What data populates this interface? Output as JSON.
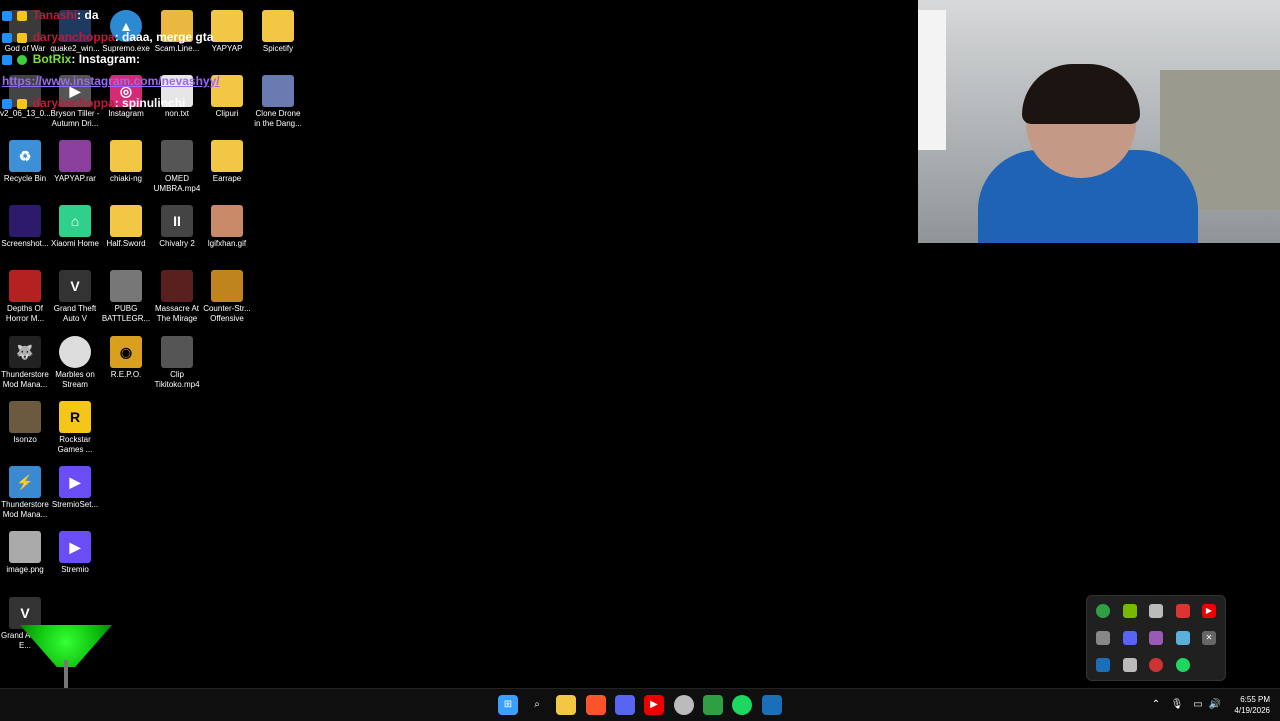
{
  "chat": [
    {
      "user": "Tanashi",
      "message": ": da",
      "user_color": "#c2183c",
      "message_color": "#ffffff"
    },
    {
      "user": "daryanchoppa",
      "message": ": daaa, merge gta",
      "user_color": "#c2183c",
      "message_color": "#ffffff"
    },
    {
      "user": "BotRix",
      "message": ": Instagram:",
      "user_color": "#7ee23e",
      "message_color": "#ffffff"
    },
    {
      "user": "",
      "message": "https://www.instagram.com/nevashyy/",
      "user_color": "#9a6af7",
      "message_color": "#9a6af7"
    },
    {
      "user": "daryanchoppa",
      "message": ": spinulinchi",
      "user_color": "#c2183c",
      "message_color": "#ffffff"
    }
  ],
  "desktop_icons": [
    {
      "label": "God of War",
      "icon": "god-of-war-icon",
      "color": "#3a3a3a"
    },
    {
      "label": "quake2_win...",
      "icon": "quake-installer-icon",
      "color": "#1e3a5f"
    },
    {
      "label": "Supremo.exe",
      "icon": "supremo-icon",
      "color": "#2b8ad1"
    },
    {
      "label": "Scam.Line...",
      "icon": "scam-line-folder-icon",
      "color": "#e8b840"
    },
    {
      "label": "YAPYAP",
      "icon": "folder-icon",
      "color": "#f2c744"
    },
    {
      "label": "Spicetify",
      "icon": "folder-icon",
      "color": "#f2c744"
    },
    {
      "label": "v2_06_13_0...",
      "icon": "video-file-icon",
      "color": "#444"
    },
    {
      "label": "Bryson Tiller - Autumn Dri...",
      "icon": "audio-file-icon",
      "color": "#555"
    },
    {
      "label": "Instagram",
      "icon": "instagram-icon",
      "color": "#d62976"
    },
    {
      "label": "non.txt",
      "icon": "text-file-icon",
      "color": "#e6e6e6"
    },
    {
      "label": "Clipuri",
      "icon": "folder-icon",
      "color": "#f2c744"
    },
    {
      "label": "Clone Drone in the Dang...",
      "icon": "clone-drone-icon",
      "color": "#6a7bb2"
    },
    {
      "label": "Recycle Bin",
      "icon": "recycle-bin-icon",
      "color": "#3d8fd6"
    },
    {
      "label": "YAPYAP.rar",
      "icon": "winrar-icon",
      "color": "#8a3f9c"
    },
    {
      "label": "chiaki-ng",
      "icon": "folder-icon",
      "color": "#f2c744"
    },
    {
      "label": "OMED UMBRA.mp4",
      "icon": "video-file-icon",
      "color": "#555"
    },
    {
      "label": "Earrape",
      "icon": "folder-icon",
      "color": "#f2c744"
    },
    {
      "label": "Screenshot...",
      "icon": "image-file-icon",
      "color": "#2b1b6a"
    },
    {
      "label": "Xiaomi Home",
      "icon": "xiaomi-home-icon",
      "color": "#2fd08a"
    },
    {
      "label": "Half.Sword",
      "icon": "folder-icon",
      "color": "#f2c744"
    },
    {
      "label": "Chivalry 2",
      "icon": "chivalry-icon",
      "color": "#444"
    },
    {
      "label": "lgifxhan.gif",
      "icon": "gif-file-icon",
      "color": "#c98a6a"
    },
    {
      "label": "Depths Of Horror M...",
      "icon": "depths-of-horror-icon",
      "color": "#b52020"
    },
    {
      "label": "Grand Theft Auto V",
      "icon": "gta-v-icon",
      "color": "#333"
    },
    {
      "label": "PUBG BATTLEGR...",
      "icon": "pubg-icon",
      "color": "#777"
    },
    {
      "label": "Massacre At The Mirage",
      "icon": "massacre-icon",
      "color": "#5a2020"
    },
    {
      "label": "Counter-Str... Offensive",
      "icon": "csgo-icon",
      "color": "#c0841e"
    },
    {
      "label": "Thunderstore Mod Mana...",
      "icon": "thunderstore-icon",
      "color": "#222"
    },
    {
      "label": "Marbles on Stream",
      "icon": "marbles-icon",
      "color": "#ddd"
    },
    {
      "label": "R.E.P.O.",
      "icon": "repo-icon",
      "color": "#d9a020"
    },
    {
      "label": "Clip Tikitoko.mp4",
      "icon": "video-file-icon",
      "color": "#555"
    },
    {
      "label": "Isonzo",
      "icon": "isonzo-icon",
      "color": "#6b5a40"
    },
    {
      "label": "Rockstar Games ...",
      "icon": "rockstar-icon",
      "color": "#f5c518"
    },
    {
      "label": "Thunderstore Mod Mana...",
      "icon": "thunderstore-icon",
      "color": "#3a8ad1"
    },
    {
      "label": "StremioSet...",
      "icon": "stremio-setup-icon",
      "color": "#6a4df5"
    },
    {
      "label": "image.png",
      "icon": "image-file-icon",
      "color": "#aaa"
    },
    {
      "label": "Stremio",
      "icon": "stremio-icon",
      "color": "#6a4df5"
    },
    {
      "label": "Grand Auto V E...",
      "icon": "gta-v-icon",
      "color": "#333"
    }
  ],
  "tray_icons": [
    {
      "icon": "xbox-icon",
      "color": "#2ea043"
    },
    {
      "icon": "nvidia-icon",
      "color": "#76b900"
    },
    {
      "icon": "headset-icon",
      "color": "#bbb"
    },
    {
      "icon": "controller-icon",
      "color": "#d33"
    },
    {
      "icon": "youtube-icon",
      "color": "#e00"
    },
    {
      "icon": "keyboard-icon",
      "color": "#888"
    },
    {
      "icon": "discord-icon",
      "color": "#5865f2"
    },
    {
      "icon": "feather-icon",
      "color": "#9b59b6"
    },
    {
      "icon": "dots-icon",
      "color": "#5ab0d8"
    },
    {
      "icon": "close-app-icon",
      "color": "#666"
    },
    {
      "icon": "steam-icon",
      "color": "#1b6eb8"
    },
    {
      "icon": "usb-icon",
      "color": "#bbb"
    },
    {
      "icon": "gamepad-icon",
      "color": "#c33"
    },
    {
      "icon": "spotify-icon",
      "color": "#1ed760"
    }
  ],
  "taskbar": {
    "apps": [
      {
        "icon": "windows-start-icon",
        "color": "#3aa0ff"
      },
      {
        "icon": "search-icon",
        "color": "#ffffff"
      },
      {
        "icon": "file-explorer-icon",
        "color": "#f2c744"
      },
      {
        "icon": "brave-icon",
        "color": "#fb542b"
      },
      {
        "icon": "discord-icon",
        "color": "#5865f2"
      },
      {
        "icon": "youtube-music-icon",
        "color": "#e00"
      },
      {
        "icon": "chrome-icon",
        "color": "#bbb"
      },
      {
        "icon": "xbox-app-icon",
        "color": "#2ea043"
      },
      {
        "icon": "spotify-icon",
        "color": "#1ed760"
      },
      {
        "icon": "steam-icon",
        "color": "#1b6eb8"
      }
    ],
    "time": "6:55 PM",
    "date": "4/19/2026"
  }
}
